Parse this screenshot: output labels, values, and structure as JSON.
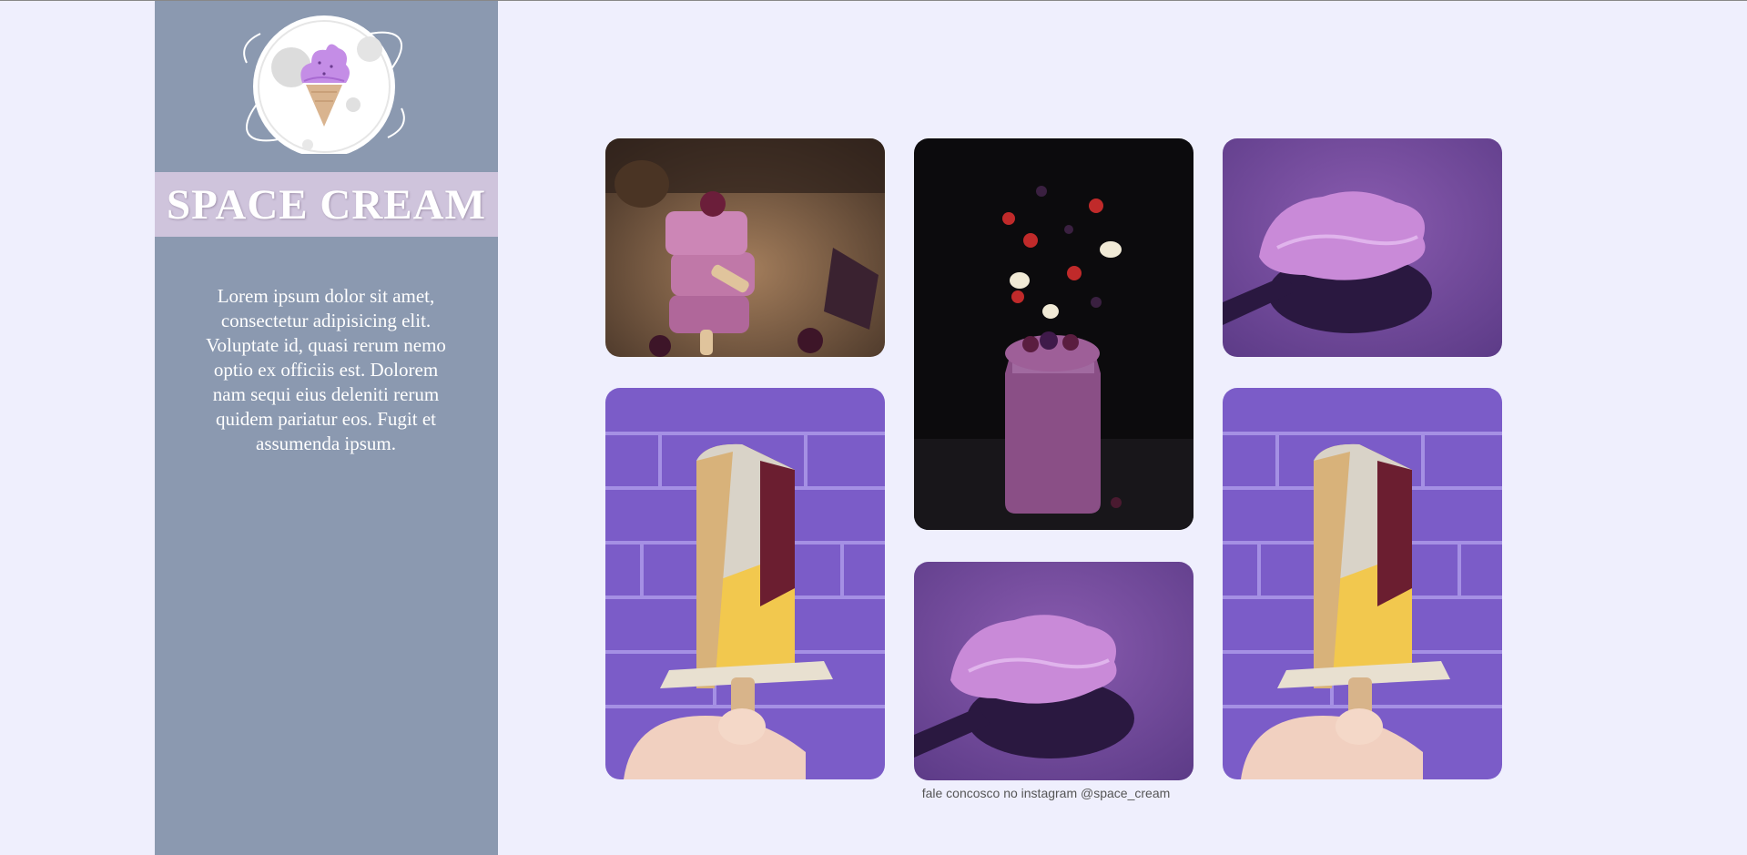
{
  "brand": {
    "title": "SPACE CREAM",
    "logo": "ice-cream-planet-logo"
  },
  "sidebar": {
    "description": "Lorem ipsum dolor sit amet, consectetur adipisicing elit. Voluptate id, quasi rerum nemo optio ex officiis est. Dolorem nam sequi eius deleniti rerum quidem pariatur eos. Fugit et assumenda ipsum."
  },
  "gallery": {
    "photos": [
      {
        "subject": "stacked purple popsicles with blackberry"
      },
      {
        "subject": "berry smoothie jar with floating fruit"
      },
      {
        "subject": "scoop of purple ice cream on spoon"
      },
      {
        "subject": "nut-coated popsicle in hand against purple brick wall"
      },
      {
        "subject": "scoop of purple ice cream on spoon"
      },
      {
        "subject": "nut-coated popsicle in hand against purple brick wall"
      }
    ]
  },
  "footer": {
    "note": "fale concosco no instagram @space_cream"
  },
  "colors": {
    "page_bg": "#efeffd",
    "sidebar_bg": "#8b99b0",
    "brand_band": "#cfc4dc",
    "accent_purple": "#7b5aa6"
  }
}
